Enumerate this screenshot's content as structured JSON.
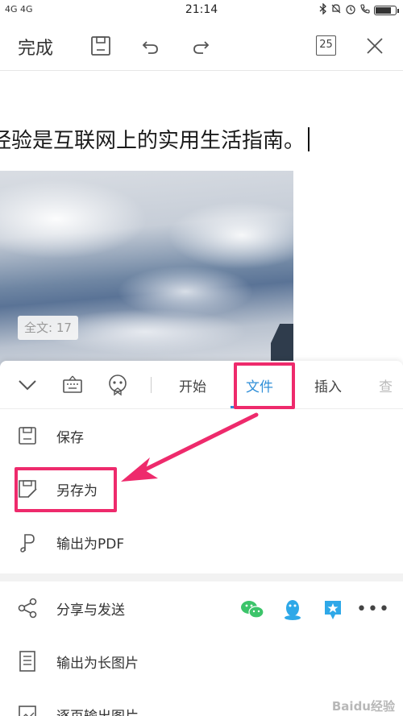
{
  "status_bar": {
    "network": "4G 4G",
    "time": "21:14",
    "battery_level": 0.85
  },
  "toolbar": {
    "done_label": "完成",
    "page_count": "25"
  },
  "document": {
    "text": "经验是互联网上的实用生活指南。",
    "word_count": "全文: 17"
  },
  "panel": {
    "tabs": [
      {
        "label": "开始"
      },
      {
        "label": "文件",
        "active": true
      },
      {
        "label": "插入"
      },
      {
        "label": "查"
      }
    ],
    "menu": {
      "save": "保存",
      "save_as": "另存为",
      "export_pdf": "输出为PDF",
      "share": "分享与发送",
      "export_long_image": "输出为长图片",
      "export_page_images": "逐页输出图片"
    },
    "share_apps": [
      "wechat-icon",
      "qq-icon",
      "tim-icon",
      "more-icon"
    ]
  },
  "colors": {
    "accent": "#2f8fd8",
    "highlight": "#ee2a6c",
    "wechat": "#3cc46a",
    "qq": "#2ea8e8"
  },
  "watermark": "Baidu经验"
}
